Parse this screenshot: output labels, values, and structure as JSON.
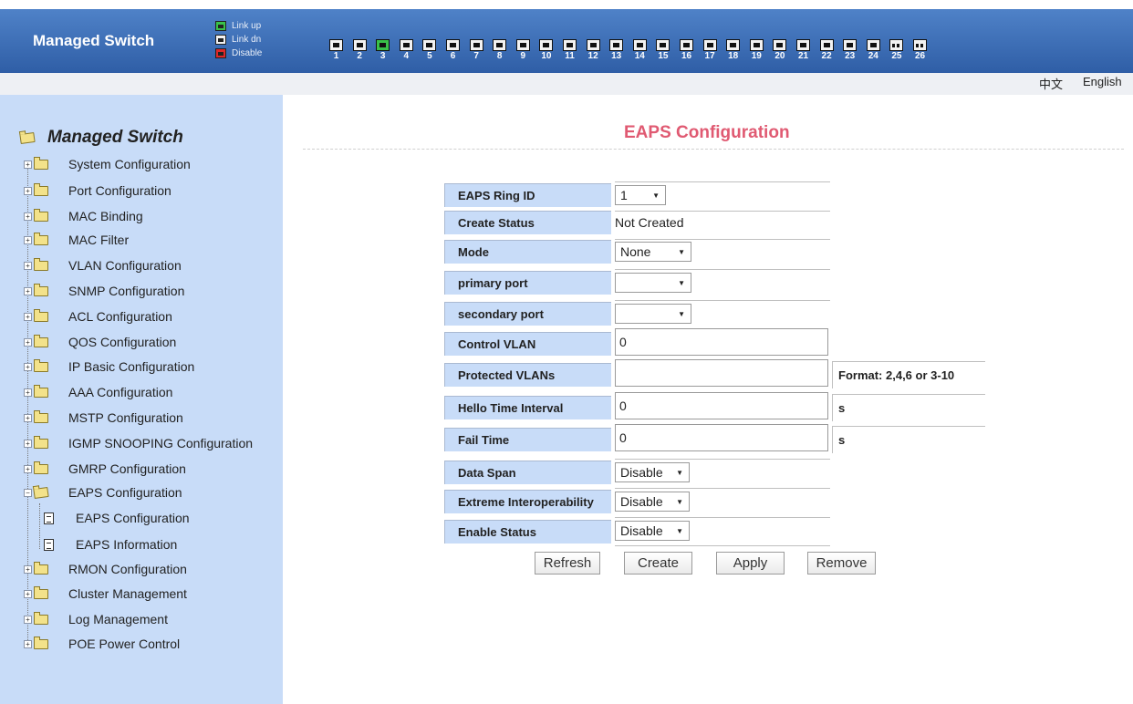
{
  "header": {
    "brand": "Managed Switch",
    "legend": [
      {
        "label": "Link up",
        "color": "#39c24a"
      },
      {
        "label": "Link dn",
        "color": "#f2f2f2"
      },
      {
        "label": "Disable",
        "color": "#e02828"
      }
    ],
    "ports": [
      {
        "num": "1",
        "state": "down"
      },
      {
        "num": "2",
        "state": "down"
      },
      {
        "num": "3",
        "state": "up"
      },
      {
        "num": "4",
        "state": "down"
      },
      {
        "num": "5",
        "state": "down"
      },
      {
        "num": "6",
        "state": "down"
      },
      {
        "num": "7",
        "state": "down"
      },
      {
        "num": "8",
        "state": "down"
      },
      {
        "num": "9",
        "state": "down"
      },
      {
        "num": "10",
        "state": "down"
      },
      {
        "num": "11",
        "state": "down"
      },
      {
        "num": "12",
        "state": "down"
      },
      {
        "num": "13",
        "state": "down"
      },
      {
        "num": "14",
        "state": "down"
      },
      {
        "num": "15",
        "state": "down"
      },
      {
        "num": "16",
        "state": "down"
      },
      {
        "num": "17",
        "state": "down"
      },
      {
        "num": "18",
        "state": "down"
      },
      {
        "num": "19",
        "state": "down"
      },
      {
        "num": "20",
        "state": "down"
      },
      {
        "num": "21",
        "state": "down"
      },
      {
        "num": "22",
        "state": "down"
      },
      {
        "num": "23",
        "state": "down"
      },
      {
        "num": "24",
        "state": "down"
      },
      {
        "num": "25",
        "state": "fiber"
      },
      {
        "num": "26",
        "state": "fiber"
      }
    ]
  },
  "language": {
    "chinese": "中文",
    "english": "English"
  },
  "sidebar": {
    "root": "Managed Switch",
    "items": [
      {
        "label": "System Configuration"
      },
      {
        "label": "Port Configuration"
      },
      {
        "label": "MAC Binding"
      },
      {
        "label": "MAC Filter"
      },
      {
        "label": "VLAN Configuration"
      },
      {
        "label": "SNMP Configuration"
      },
      {
        "label": "ACL Configuration"
      },
      {
        "label": "QOS Configuration"
      },
      {
        "label": "IP Basic Configuration"
      },
      {
        "label": "AAA Configuration"
      },
      {
        "label": "MSTP Configuration"
      },
      {
        "label": "IGMP SNOOPING Configuration"
      },
      {
        "label": "GMRP Configuration"
      },
      {
        "label": "EAPS Configuration"
      },
      {
        "label": "RMON Configuration"
      },
      {
        "label": "Cluster Management"
      },
      {
        "label": "Log Management"
      },
      {
        "label": "POE Power Control"
      }
    ],
    "eaps_children": [
      {
        "label": "EAPS Configuration"
      },
      {
        "label": "EAPS Information"
      }
    ]
  },
  "main": {
    "title": "EAPS Configuration",
    "fields": {
      "ring_id": {
        "label": "EAPS Ring ID",
        "value": "1"
      },
      "create_status": {
        "label": "Create Status",
        "value": "Not Created"
      },
      "mode": {
        "label": "Mode",
        "value": "None"
      },
      "primary_port": {
        "label": "primary port",
        "value": ""
      },
      "secondary_port": {
        "label": "secondary port",
        "value": ""
      },
      "control_vlan": {
        "label": "Control VLAN",
        "value": "0"
      },
      "protected_vlans": {
        "label": "Protected VLANs",
        "value": "",
        "hint": "Format: 2,4,6 or 3-10"
      },
      "hello_time": {
        "label": "Hello Time Interval",
        "value": "0",
        "unit": "s"
      },
      "fail_time": {
        "label": "Fail Time",
        "value": "0",
        "unit": "s"
      },
      "data_span": {
        "label": "Data Span",
        "value": "Disable"
      },
      "extreme_interop": {
        "label": "Extreme Interoperability",
        "value": "Disable"
      },
      "enable_status": {
        "label": "Enable Status",
        "value": "Disable"
      }
    },
    "buttons": {
      "refresh": "Refresh",
      "create": "Create",
      "apply": "Apply",
      "remove": "Remove"
    }
  }
}
